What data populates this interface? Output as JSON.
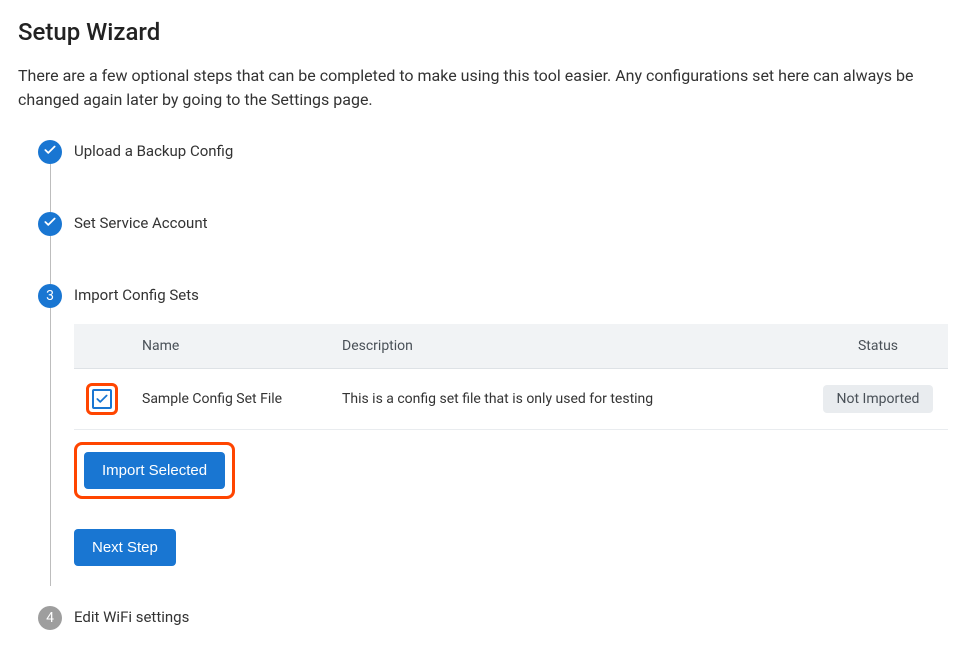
{
  "page": {
    "title": "Setup Wizard",
    "description": "There are a few optional steps that can be completed to make using this tool easier. Any configurations set here can always be changed again later by going to the Settings page."
  },
  "steps": [
    {
      "label": "Upload a Backup Config",
      "state": "done"
    },
    {
      "label": "Set Service Account",
      "state": "done"
    },
    {
      "label": "Import Config Sets",
      "state": "current",
      "number": "3"
    },
    {
      "label": "Edit WiFi settings",
      "state": "pending",
      "number": "4"
    }
  ],
  "table": {
    "headers": {
      "name": "Name",
      "description": "Description",
      "status": "Status"
    },
    "rows": [
      {
        "checked": true,
        "name": "Sample Config Set File",
        "description": "This is a config set file that is only used for testing",
        "status": "Not Imported"
      }
    ]
  },
  "buttons": {
    "import_selected": "Import Selected",
    "next_step": "Next Step"
  }
}
